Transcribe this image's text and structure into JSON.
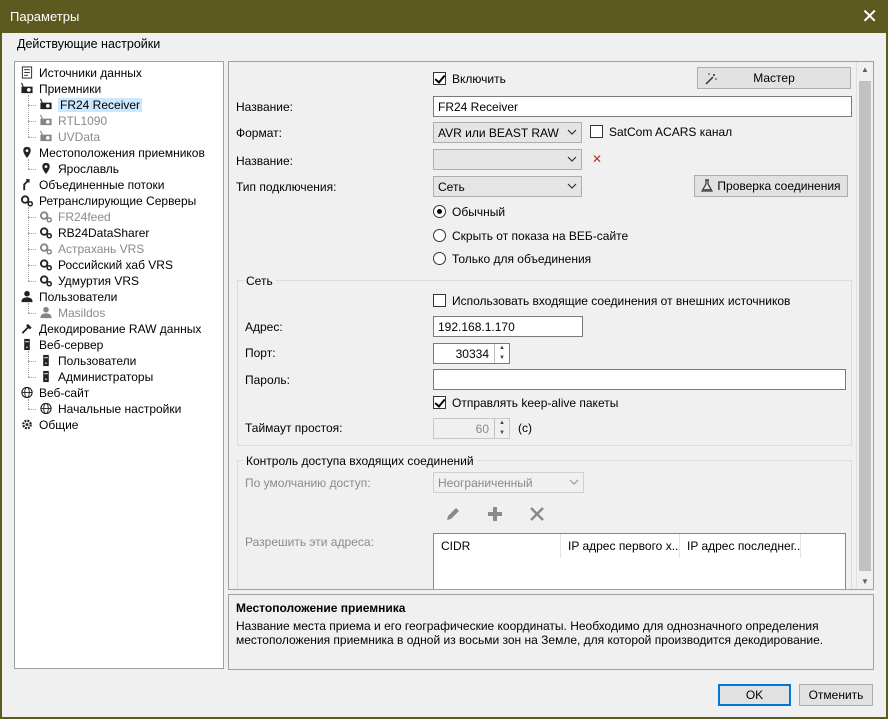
{
  "window": {
    "title": "Параметры",
    "close_glyph": "✕"
  },
  "section_title": "Действующие настройки",
  "tree": {
    "items": [
      {
        "label": "Источники данных",
        "icon": "document-icon",
        "level": 0,
        "disabled": false,
        "selected": false
      },
      {
        "label": "Приемники",
        "icon": "receiver-icon",
        "level": 0,
        "disabled": false,
        "selected": false
      },
      {
        "label": "FR24 Receiver",
        "icon": "receiver-icon",
        "level": 1,
        "disabled": false,
        "selected": true
      },
      {
        "label": "RTL1090",
        "icon": "receiver-icon",
        "level": 1,
        "disabled": true,
        "selected": false
      },
      {
        "label": "UVData",
        "icon": "receiver-icon",
        "level": 1,
        "disabled": true,
        "selected": false
      },
      {
        "label": "Местоположения приемников",
        "icon": "location-pin-icon",
        "level": 0,
        "disabled": false,
        "selected": false
      },
      {
        "label": "Ярославль",
        "icon": "location-pin-icon",
        "level": 1,
        "disabled": false,
        "selected": false
      },
      {
        "label": "Объединенные потоки",
        "icon": "merge-icon",
        "level": 0,
        "disabled": false,
        "selected": false
      },
      {
        "label": "Ретранслирующие Серверы",
        "icon": "gears-icon",
        "level": 0,
        "disabled": false,
        "selected": false
      },
      {
        "label": "FR24feed",
        "icon": "gears-icon",
        "level": 1,
        "disabled": true,
        "selected": false
      },
      {
        "label": "RB24DataSharer",
        "icon": "gears-icon",
        "level": 1,
        "disabled": false,
        "selected": false
      },
      {
        "label": "Астрахань VRS",
        "icon": "gears-icon",
        "level": 1,
        "disabled": true,
        "selected": false
      },
      {
        "label": "Российский хаб VRS",
        "icon": "gears-icon",
        "level": 1,
        "disabled": false,
        "selected": false
      },
      {
        "label": "Удмуртия VRS",
        "icon": "gears-icon",
        "level": 1,
        "disabled": false,
        "selected": false
      },
      {
        "label": "Пользователи",
        "icon": "user-icon",
        "level": 0,
        "disabled": false,
        "selected": false
      },
      {
        "label": "Masildos",
        "icon": "user-icon",
        "level": 1,
        "disabled": true,
        "selected": false
      },
      {
        "label": "Декодирование RAW данных",
        "icon": "decode-icon",
        "level": 0,
        "disabled": false,
        "selected": false
      },
      {
        "label": "Веб-сервер",
        "icon": "server-icon",
        "level": 0,
        "disabled": false,
        "selected": false
      },
      {
        "label": "Пользователи",
        "icon": "server-icon",
        "level": 1,
        "disabled": false,
        "selected": false
      },
      {
        "label": "Администраторы",
        "icon": "server-icon",
        "level": 1,
        "disabled": false,
        "selected": false
      },
      {
        "label": "Веб-сайт",
        "icon": "globe-icon",
        "level": 0,
        "disabled": false,
        "selected": false
      },
      {
        "label": "Начальные настройки",
        "icon": "globe-icon",
        "level": 1,
        "disabled": false,
        "selected": false
      },
      {
        "label": "Общие",
        "icon": "gear-icon",
        "level": 0,
        "disabled": false,
        "selected": false
      }
    ]
  },
  "form": {
    "enable_label": "Включить",
    "enable_checked": true,
    "wizard_label": "Мастер",
    "name_label": "Название:",
    "name_value": "FR24 Receiver",
    "format_label": "Формат:",
    "format_value": "AVR или BEAST RAW",
    "satcom_label": "SatCom ACARS канал",
    "satcom_checked": false,
    "name2_label": "Название:",
    "name2_value": "",
    "clear_glyph": "✕",
    "conn_type_label": "Тип подключения:",
    "conn_type_value": "Сеть",
    "test_conn_label": "Проверка соединения",
    "radio_normal": "Обычный",
    "radio_hide": "Скрыть от показа на ВЕБ-сайте",
    "radio_merge_only": "Только для объединения",
    "radio_selected": "normal"
  },
  "network": {
    "group_title": "Сеть",
    "incoming_label": "Использовать входящие соединения от внешних источников",
    "incoming_checked": false,
    "address_label": "Адрес:",
    "address_value": "192.168.1.170",
    "port_label": "Порт:",
    "port_value": "30334",
    "password_label": "Пароль:",
    "password_value": "",
    "keepalive_label": "Отправлять keep-alive пакеты",
    "keepalive_checked": true,
    "timeout_label": "Таймаут простоя:",
    "timeout_value": "60",
    "timeout_unit": "(с)"
  },
  "access": {
    "group_title": "Контроль доступа входящих соединений",
    "default_label": "По умолчанию доступ:",
    "default_value": "Неограниченный",
    "allow_label": "Разрешить эти адреса:",
    "columns": [
      "CIDR",
      "IP адрес первого х...",
      "IP адрес последнег..."
    ]
  },
  "description": {
    "title": "Местоположение приемника",
    "text": "Название места приема и его географические координаты. Необходимо для однозначного определения местоположения приемника в одной из восьми зон на Земле, для которой производится декодирование."
  },
  "buttons": {
    "ok": "OK",
    "cancel": "Отменить"
  },
  "colors": {
    "titlebar": "#5c5a1f",
    "selection": "#cce8ff",
    "primary_border": "#0078d7",
    "clear_icon": "#c42b1c"
  }
}
